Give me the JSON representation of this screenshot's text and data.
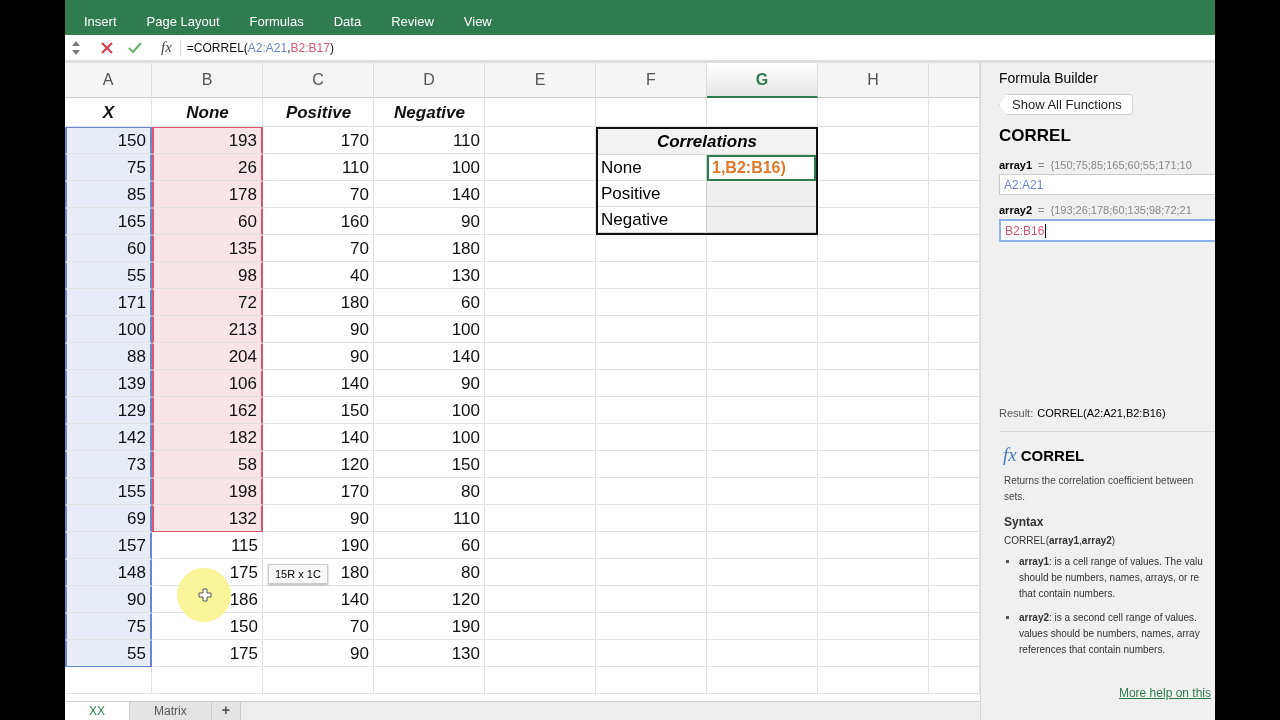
{
  "ribbon": {
    "tabs": [
      "Insert",
      "Page Layout",
      "Formulas",
      "Data",
      "Review",
      "View"
    ]
  },
  "formula_bar": {
    "fx": "fx",
    "formula": [
      {
        "text": "=CORREL("
      },
      {
        "text": "A2:A21",
        "color": "#6a86cf"
      },
      {
        "text": ","
      },
      {
        "text": "B2:B17",
        "color": "#d9576f"
      },
      {
        "text": ")"
      }
    ]
  },
  "sheet": {
    "columns": [
      {
        "label": "A",
        "selected": false
      },
      {
        "label": "B",
        "selected": false
      },
      {
        "label": "C",
        "selected": false
      },
      {
        "label": "D",
        "selected": false
      },
      {
        "label": "E",
        "selected": false
      },
      {
        "label": "F",
        "selected": false
      },
      {
        "label": "G",
        "selected": true
      },
      {
        "label": "H",
        "selected": false
      }
    ],
    "header_row": [
      "X",
      "None",
      "Positive",
      "Negative"
    ],
    "rows": [
      [
        {
          "text": "150",
          "color": "#6a86cf"
        },
        {
          "text": "193",
          "color": "#d9576f"
        },
        {
          "text": "170"
        },
        {
          "text": "110"
        }
      ],
      [
        {
          "text": "75",
          "color": "#6a86cf"
        },
        {
          "text": "26",
          "color": "#d9576f"
        },
        {
          "text": "110"
        },
        {
          "text": "100"
        }
      ],
      [
        {
          "text": "85",
          "color": "#6a86cf"
        },
        {
          "text": "178",
          "color": "#d9576f"
        },
        {
          "text": "70"
        },
        {
          "text": "140"
        }
      ],
      [
        {
          "text": "165",
          "color": "#6a86cf"
        },
        {
          "text": "60",
          "color": "#d9576f"
        },
        {
          "text": "160"
        },
        {
          "text": "90"
        }
      ],
      [
        {
          "text": "60",
          "color": "#6a86cf"
        },
        {
          "text": "135",
          "color": "#d9576f"
        },
        {
          "text": "70"
        },
        {
          "text": "180"
        }
      ],
      [
        {
          "text": "55",
          "color": "#6a86cf"
        },
        {
          "text": "98",
          "color": "#d9576f"
        },
        {
          "text": "40"
        },
        {
          "text": "130"
        }
      ],
      [
        {
          "text": "171",
          "color": "#6a86cf"
        },
        {
          "text": "72",
          "color": "#d9576f"
        },
        {
          "text": "180"
        },
        {
          "text": "60"
        }
      ],
      [
        {
          "text": "100",
          "color": "#6a86cf"
        },
        {
          "text": "213",
          "color": "#d9576f"
        },
        {
          "text": "90"
        },
        {
          "text": "100"
        }
      ],
      [
        {
          "text": "88",
          "color": "#6a86cf"
        },
        {
          "text": "204",
          "color": "#d9576f"
        },
        {
          "text": "90"
        },
        {
          "text": "140"
        }
      ],
      [
        {
          "text": "139",
          "color": "#6a86cf"
        },
        {
          "text": "106",
          "color": "#d9576f"
        },
        {
          "text": "140"
        },
        {
          "text": "90"
        }
      ],
      [
        {
          "text": "129",
          "color": "#6a86cf"
        },
        {
          "text": "162",
          "color": "#d9576f"
        },
        {
          "text": "150"
        },
        {
          "text": "100"
        }
      ],
      [
        {
          "text": "142",
          "color": "#6a86cf"
        },
        {
          "text": "182",
          "color": "#d9576f"
        },
        {
          "text": "140"
        },
        {
          "text": "100"
        }
      ],
      [
        {
          "text": "73",
          "color": "#6a86cf"
        },
        {
          "text": "58",
          "color": "#d9576f"
        },
        {
          "text": "120"
        },
        {
          "text": "150"
        }
      ],
      [
        {
          "text": "155",
          "color": "#6a86cf"
        },
        {
          "text": "198",
          "color": "#d9576f"
        },
        {
          "text": "170"
        },
        {
          "text": "80"
        }
      ],
      [
        {
          "text": "69",
          "color": "#6a86cf"
        },
        {
          "text": "132",
          "color": "#d9576f"
        },
        {
          "text": "90"
        },
        {
          "text": "110"
        }
      ],
      [
        {
          "text": "157",
          "color": "#6a86cf"
        },
        {
          "text": "115"
        },
        {
          "text": "190"
        },
        {
          "text": "60"
        }
      ],
      [
        {
          "text": "148",
          "color": "#6a86cf"
        },
        {
          "text": "175"
        },
        {
          "text": "180"
        },
        {
          "text": "80"
        }
      ],
      [
        {
          "text": "90",
          "color": "#6a86cf"
        },
        {
          "text": "186"
        },
        {
          "text": "140"
        },
        {
          "text": "120"
        }
      ],
      [
        {
          "text": "75",
          "color": "#6a86cf"
        },
        {
          "text": "150"
        },
        {
          "text": "70"
        },
        {
          "text": "190"
        }
      ],
      [
        {
          "text": "55",
          "color": "#6a86cf"
        },
        {
          "text": "175"
        },
        {
          "text": "90"
        },
        {
          "text": "130"
        }
      ]
    ],
    "correlations": {
      "title": "Correlations",
      "rows": [
        {
          "label": "None",
          "value": "1,B2:B16)",
          "editing": true
        },
        {
          "label": "Positive",
          "editing": false
        },
        {
          "label": "Negative",
          "editing": false
        }
      ]
    },
    "drag_tooltip": "15R x 1C"
  },
  "sheet_tabs": {
    "tabs": [
      {
        "label": "XX",
        "selected": true
      },
      {
        "label": "Matrix",
        "selected": false
      }
    ],
    "add": "+"
  },
  "formula_builder": {
    "title": "Formula Builder",
    "back_button": "Show All Functions",
    "function": "CORREL",
    "arguments": [
      {
        "name": "array1",
        "equals": "=",
        "preview": "{150;75;85;165;60;55;171;10",
        "value": "A2:A21",
        "color": "#6a86cf",
        "focused": false
      },
      {
        "name": "array2",
        "equals": "=",
        "preview": "{193;26;178;60;135;98;72;21",
        "value": "B2:B16",
        "color": "#d9576f",
        "focused": true
      }
    ],
    "result_label": "Result:",
    "result": "CORREL(A2:A21,B2:B16)",
    "help": {
      "fx": "fx",
      "name": "CORREL",
      "description": [
        "Returns the correlation coefficient between",
        "sets."
      ],
      "syntax_heading": "Syntax",
      "syntax": "CORREL(**array1**,**array2**)",
      "bullets": [
        [
          "**array1**: is a cell range of values. The valu",
          "should be numbers, names, arrays, or re",
          "that contain numbers."
        ],
        [
          "**array2**: is a second cell range of values.",
          "values should be numbers, names, array",
          "references that contain numbers."
        ]
      ],
      "more_help": "More help on this"
    }
  }
}
